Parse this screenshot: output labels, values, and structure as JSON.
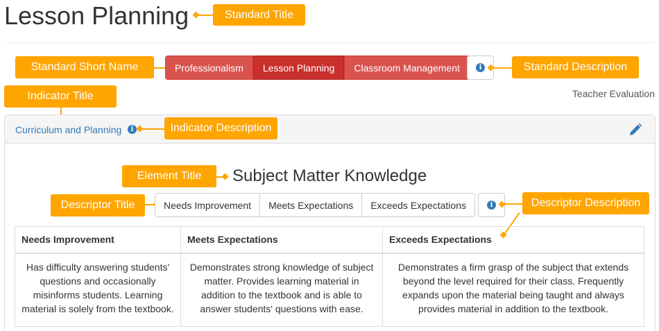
{
  "page": {
    "title": "Lesson Planning"
  },
  "annotations": {
    "standard_title": "Standard Title",
    "standard_short_name": "Standard Short Name",
    "standard_description": "Standard Description",
    "indicator_title": "Indicator Title",
    "indicator_description": "Indicator Description",
    "element_title": "Element Title",
    "descriptor_title": "Descriptor Title",
    "descriptor_description": "Descriptor Description"
  },
  "standards": {
    "items": [
      {
        "label": "Professionalism",
        "active": false
      },
      {
        "label": "Lesson Planning",
        "active": true
      },
      {
        "label": "Classroom Management",
        "active": false
      }
    ],
    "info_icon": "info-circle-icon"
  },
  "evaluation": {
    "label": "Teacher Evaluation"
  },
  "indicator": {
    "title": "Curriculum and Planning",
    "info_icon": "info-circle-icon",
    "edit_icon": "pencil-icon"
  },
  "element": {
    "title": "Subject Matter Knowledge"
  },
  "descriptors": {
    "buttons": [
      "Needs Improvement",
      "Meets Expectations",
      "Exceeds Expectations"
    ],
    "info_icon": "info-circle-icon"
  },
  "table": {
    "headers": [
      "Needs Improvement",
      "Meets Expectations",
      "Exceeds Expectations"
    ],
    "rows": [
      [
        "Has difficulty answering students' questions and occasionally misinforms students. Learning material is solely from the textbook.",
        "Demonstrates strong knowledge of subject matter. Provides learning material in addition to the textbook and is able to answer students' questions with ease.",
        "Demonstrates a firm grasp of the subject that extends beyond the level required for their class. Frequently expands upon the material being taught and always provides material in addition to the textbook."
      ]
    ]
  },
  "colors": {
    "callout": "#ffa500",
    "standard_button": "#d9534f",
    "standard_button_active": "#c9302c",
    "link": "#337ab7"
  }
}
